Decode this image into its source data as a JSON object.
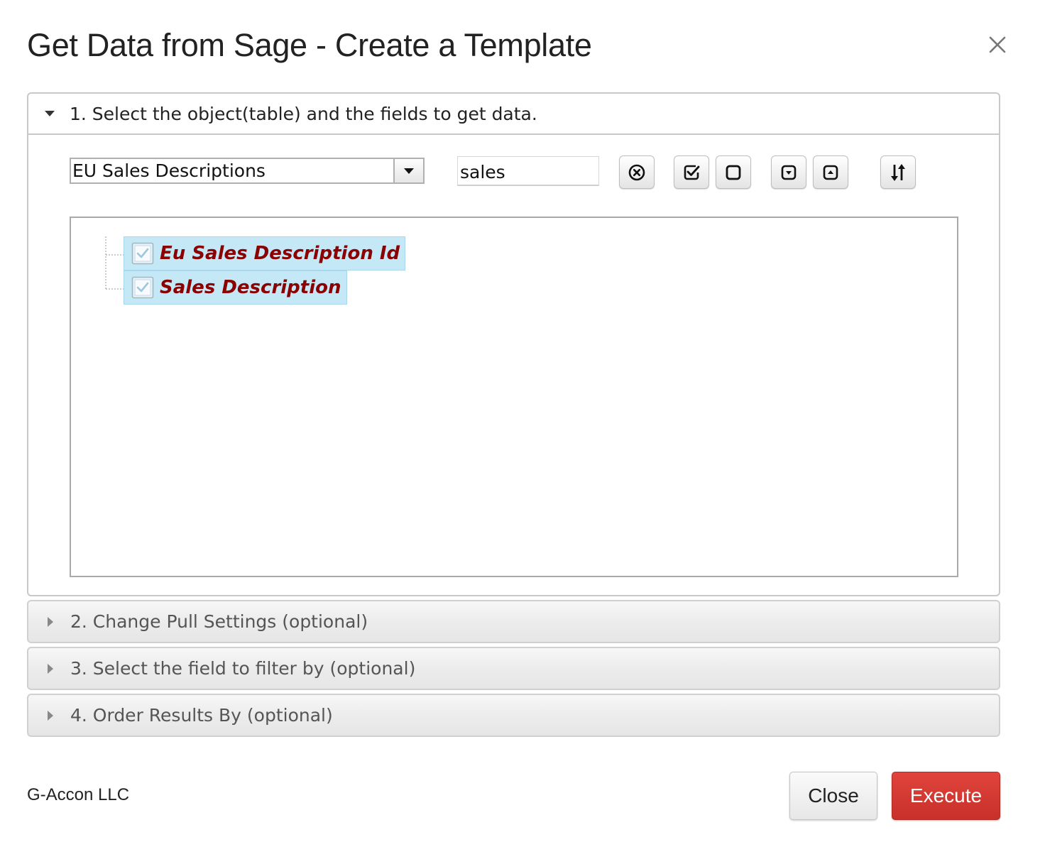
{
  "dialog": {
    "title": "Get Data from Sage - Create a Template",
    "close_icon": "close-icon"
  },
  "step1": {
    "title": "1. Select the object(table) and the fields to get data.",
    "expanded": true,
    "object_select": {
      "value": "EU Sales Descriptions"
    },
    "field_search": {
      "value": "sales"
    },
    "toolbar": [
      {
        "name": "clear-search-button",
        "icon": "clear-circle-x-icon"
      },
      {
        "name": "check-all-button",
        "icon": "checkbox-checked-icon"
      },
      {
        "name": "uncheck-all-button",
        "icon": "checkbox-empty-icon"
      },
      {
        "name": "expand-all-button",
        "icon": "chevron-down-box-icon"
      },
      {
        "name": "collapse-all-button",
        "icon": "chevron-up-box-icon"
      },
      {
        "name": "sort-button",
        "icon": "sort-arrows-icon"
      }
    ],
    "fields": [
      {
        "label": "Eu Sales Description Id",
        "checked": true
      },
      {
        "label": "Sales Description",
        "checked": true
      }
    ]
  },
  "step2": {
    "title": "2. Change Pull Settings (optional)",
    "expanded": false
  },
  "step3": {
    "title": "3. Select the field to filter by (optional)",
    "expanded": false
  },
  "step4": {
    "title": "4. Order Results By (optional)",
    "expanded": false
  },
  "footer": {
    "brand": "G-Accon LLC",
    "close_label": "Close",
    "execute_label": "Execute"
  },
  "colors": {
    "selected_node_bg": "#c5e8f7",
    "field_label": "#8b0000",
    "execute_button": "#d23a33"
  }
}
